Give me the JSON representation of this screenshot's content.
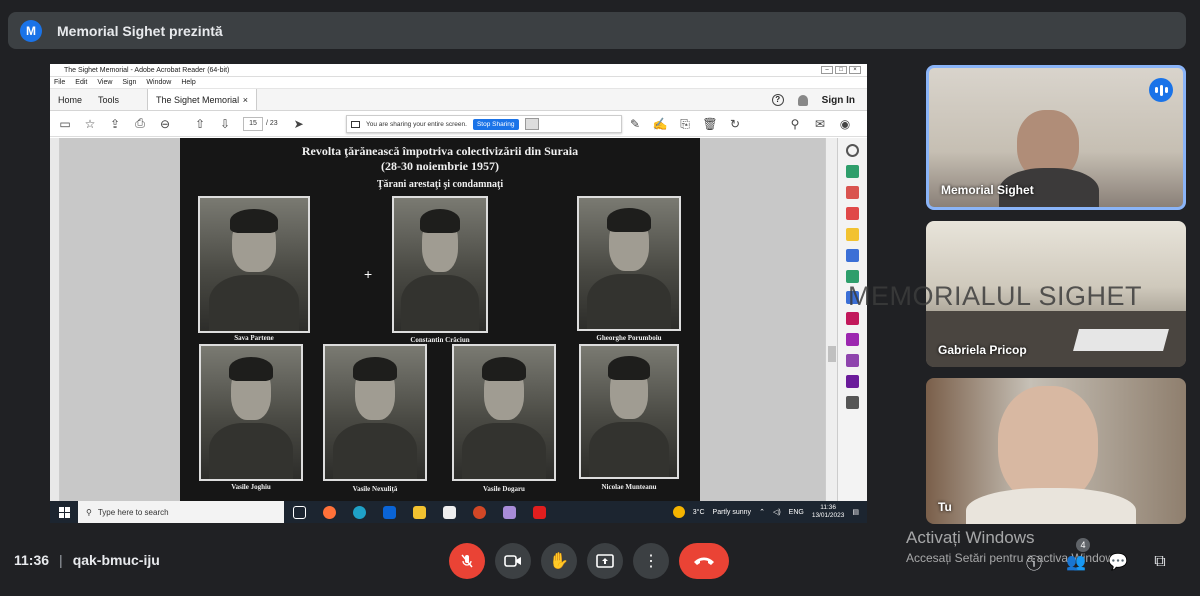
{
  "meet": {
    "avatar_letter": "M",
    "title": "Memorial Sighet prezintă",
    "time": "11:36",
    "meeting_code": "qak-bmuc-iju",
    "participants_count": "4"
  },
  "acrobat": {
    "window_title": "The Sighet Memorial - Adobe Acrobat Reader (64-bit)",
    "menu": [
      "File",
      "Edit",
      "View",
      "Sign",
      "Window",
      "Help"
    ],
    "tabs": {
      "home": "Home",
      "tools": "Tools",
      "doc": "The Sighet Memorial"
    },
    "sign_in": "Sign In",
    "page_current": "15",
    "page_total": "/ 23",
    "share_text": "You are sharing your entire screen.",
    "stop_sharing": "Stop Sharing"
  },
  "document": {
    "title_line1": "Revolta ţărănească împotriva colectivizării din Suraia",
    "title_line2": "(28-30 noiembrie 1957)",
    "subtitle": "Ţărani arestaţi şi condamnaţi",
    "people": [
      "Sava Partene",
      "Constantin Crăciun",
      "Gheorghe Porumboiu",
      "Vasile Joghiu",
      "Vasile Nexuliţă",
      "Vasile Dogaru",
      "Nicolae Munteanu"
    ]
  },
  "taskbar": {
    "search_placeholder": "Type here to search",
    "temperature": "3°C",
    "weather": "Partly sunny",
    "lang": "ENG",
    "clock_time": "11:36",
    "clock_date": "13/01/2023"
  },
  "tiles": [
    {
      "name": "Memorial Sighet"
    },
    {
      "name": "Gabriela Pricop",
      "watermark": "MEMORIALUL SIGHET"
    },
    {
      "name": "Tu"
    }
  ],
  "windows_notice": {
    "line1": "Activați Windows",
    "line2": "Accesați Setări pentru a activa Windows."
  },
  "colors": {
    "meet_bg": "#202124",
    "accent_blue": "#1a73e8",
    "end_call_red": "#ea4335"
  }
}
